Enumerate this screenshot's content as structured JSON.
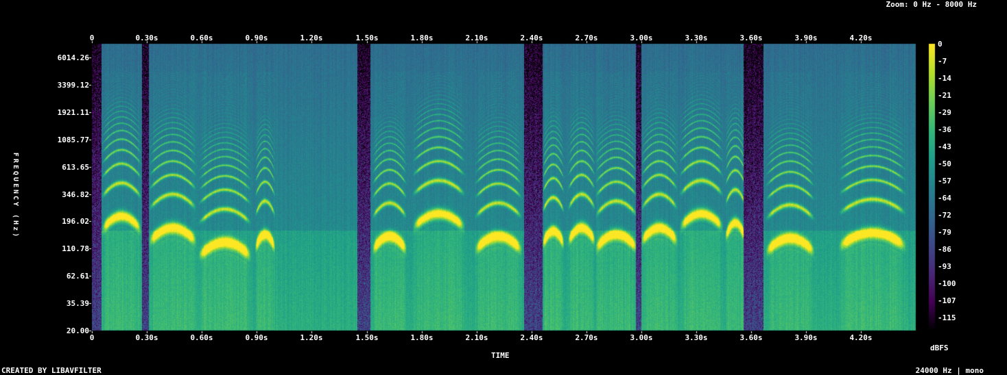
{
  "header": {
    "zoom": "Zoom: 0 Hz - 8000 Hz"
  },
  "footer": {
    "created_by": "CREATED BY LIBAVFILTER",
    "sample_info": "24000 Hz | mono"
  },
  "colorbar": {
    "unit": "dBFS",
    "ticks": [
      "0",
      "-7",
      "-14",
      "-21",
      "-29",
      "-36",
      "-43",
      "-50",
      "-57",
      "-64",
      "-72",
      "-79",
      "-86",
      "-93",
      "-100",
      "-107",
      "-115"
    ],
    "colormap": [
      "#fde725",
      "#b5de2b",
      "#6ece58",
      "#35b779",
      "#1f9e89",
      "#26828e",
      "#31688e",
      "#3e4989",
      "#482878",
      "#440154",
      "#000000"
    ]
  },
  "chart_data": {
    "type": "heatmap",
    "title": "",
    "xlabel": "TIME",
    "ylabel": "FREQUENCY (Hz)",
    "x_ticks": [
      "0",
      "0.30s",
      "0.60s",
      "0.90s",
      "1.20s",
      "1.50s",
      "1.80s",
      "2.10s",
      "2.40s",
      "2.70s",
      "3.00s",
      "3.30s",
      "3.60s",
      "3.90s",
      "4.20s"
    ],
    "y_ticks": [
      "6014.26",
      "3399.12",
      "1921.11",
      "1085.77",
      "613.65",
      "346.82",
      "196.02",
      "110.78",
      "62.61",
      "35.39",
      "20.00"
    ],
    "x_range_s": [
      0,
      4.45
    ],
    "y_range_hz": [
      20,
      8000
    ],
    "y_scale": "log",
    "z_range_dbfs": [
      -120,
      0
    ],
    "voiced_segments": [
      {
        "start": 0.05,
        "end": 0.27,
        "f0": 190
      },
      {
        "start": 0.31,
        "end": 0.57,
        "f0": 150
      },
      {
        "start": 0.58,
        "end": 0.87,
        "f0": 110
      },
      {
        "start": 0.89,
        "end": 1.0,
        "f0": 130
      },
      {
        "start": 1.53,
        "end": 1.72,
        "f0": 125
      },
      {
        "start": 1.75,
        "end": 2.04,
        "f0": 200
      },
      {
        "start": 2.09,
        "end": 2.35,
        "f0": 125
      },
      {
        "start": 2.46,
        "end": 2.58,
        "f0": 140
      },
      {
        "start": 2.6,
        "end": 2.75,
        "f0": 150
      },
      {
        "start": 2.75,
        "end": 2.98,
        "f0": 130
      },
      {
        "start": 3.0,
        "end": 3.2,
        "f0": 150
      },
      {
        "start": 3.21,
        "end": 3.45,
        "f0": 200
      },
      {
        "start": 3.46,
        "end": 3.57,
        "f0": 165
      },
      {
        "start": 3.68,
        "end": 3.95,
        "f0": 120
      },
      {
        "start": 4.08,
        "end": 4.45,
        "f0": 135
      }
    ],
    "silent_gaps": [
      {
        "start": 0.0,
        "end": 0.05
      },
      {
        "start": 0.27,
        "end": 0.31
      },
      {
        "start": 1.45,
        "end": 1.52
      },
      {
        "start": 2.36,
        "end": 2.46
      },
      {
        "start": 2.97,
        "end": 3.0
      },
      {
        "start": 3.56,
        "end": 3.67
      }
    ]
  }
}
